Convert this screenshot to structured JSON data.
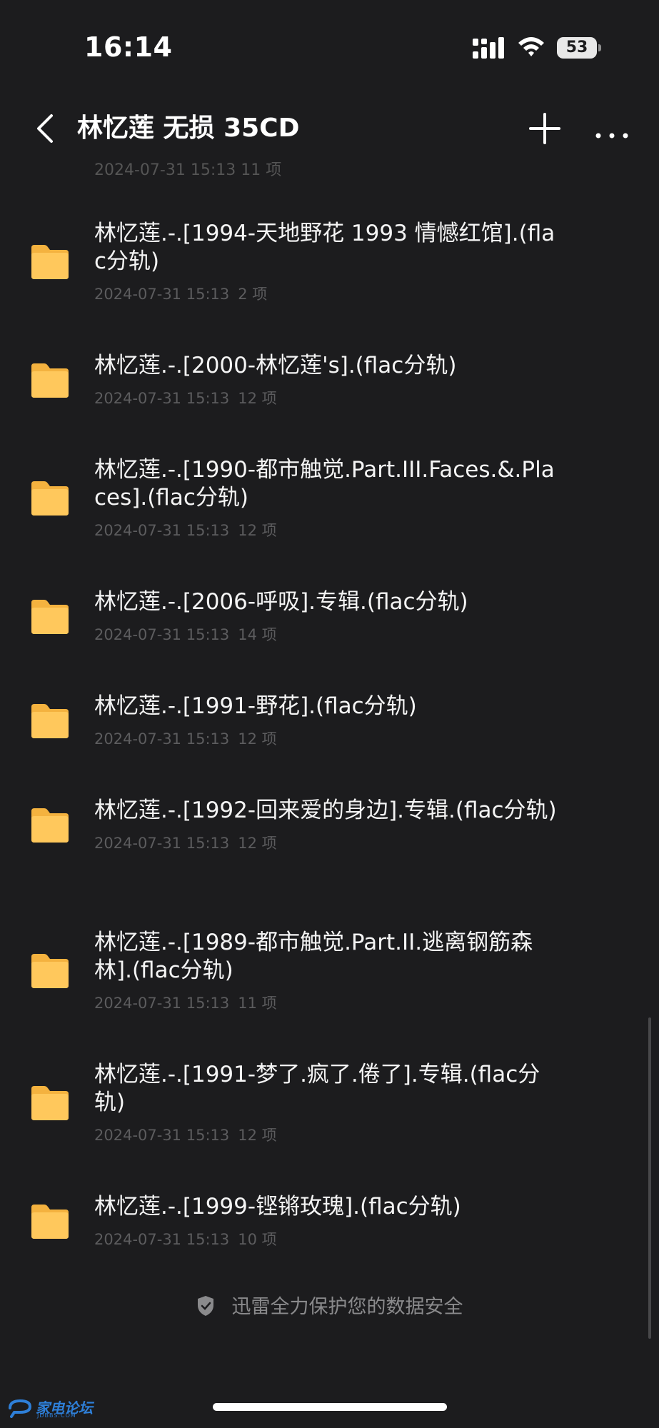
{
  "status_bar": {
    "time": "16:14",
    "battery_level": "53"
  },
  "nav": {
    "title": "林忆莲 无损 35CD"
  },
  "list": {
    "partial_row_meta": "2024-07-31 15:13  11 项",
    "files": [
      {
        "name": "林忆莲.-.[1994-天地野花 1993 情憾红馆].(flac分轨)",
        "date": "2024-07-31 15:13",
        "count": "2 项"
      },
      {
        "name": "林忆莲.-.[2000-林忆莲's].(flac分轨)",
        "date": "2024-07-31 15:13",
        "count": "12 项"
      },
      {
        "name": "林忆莲.-.[1990-都市触觉.Part.III.Faces.&.Places].(flac分轨)",
        "date": "2024-07-31 15:13",
        "count": "12 项"
      },
      {
        "name": "林忆莲.-.[2006-呼吸].专辑.(flac分轨)",
        "date": "2024-07-31 15:13",
        "count": "14 项"
      },
      {
        "name": "林忆莲.-.[1991-野花].(flac分轨)",
        "date": "2024-07-31 15:13",
        "count": "12 项"
      },
      {
        "name": "林忆莲.-.[1992-回来爱的身边].专辑.(flac分轨)",
        "date": "2024-07-31 15:13",
        "count": "12 项"
      },
      {
        "name": "林忆莲.-.[1989-都市触觉.Part.II.逃离钢筋森林].(flac分轨)",
        "date": "2024-07-31 15:13",
        "count": "11 项"
      },
      {
        "name": "林忆莲.-.[1991-梦了.疯了.倦了].专辑.(flac分轨)",
        "date": "2024-07-31 15:13",
        "count": "12 项"
      },
      {
        "name": "林忆莲.-.[1999-铿锵玫瑰].(flac分轨)",
        "date": "2024-07-31 15:13",
        "count": "10 项"
      }
    ]
  },
  "footer": {
    "security_note": "迅雷全力保护您的数据安全"
  },
  "watermark": {
    "text": "家电论坛",
    "sub": "JDBBS.COM"
  },
  "colors": {
    "background": "#1c1c1e",
    "folder": "#ffc85c",
    "meta_text": "#5c5c5e"
  },
  "icons": [
    "back-icon",
    "add-icon",
    "more-icon",
    "folder-icon",
    "shield-icon",
    "signal-icon",
    "wifi-icon",
    "battery-icon"
  ]
}
